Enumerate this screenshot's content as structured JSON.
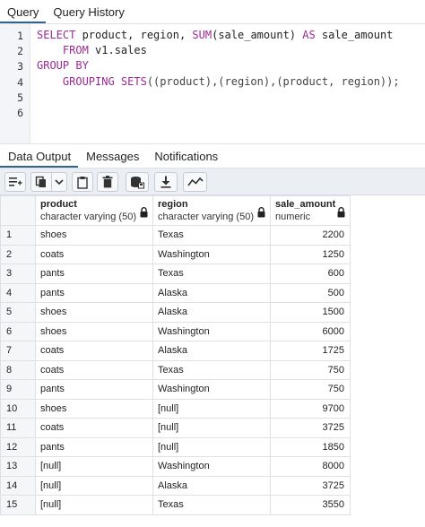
{
  "query_tabs": [
    "Query",
    "Query History"
  ],
  "editor": {
    "line_numbers": [
      "1",
      "2",
      "3",
      "4",
      "5",
      "6"
    ],
    "lines": [
      [
        {
          "t": "SELECT",
          "k": "kw"
        },
        {
          "t": " product, region, ",
          "k": "id"
        },
        {
          "t": "SUM",
          "k": "kw"
        },
        {
          "t": "(sale_amount) ",
          "k": "id"
        },
        {
          "t": "AS",
          "k": "kw"
        },
        {
          "t": " sale_amount",
          "k": "id"
        }
      ],
      [
        {
          "t": "    ",
          "k": "id"
        },
        {
          "t": "FROM",
          "k": "kw"
        },
        {
          "t": " v1.sales",
          "k": "id"
        }
      ],
      [
        {
          "t": "GROUP BY",
          "k": "kw"
        }
      ],
      [
        {
          "t": "    ",
          "k": "id"
        },
        {
          "t": "GROUPING SETS",
          "k": "kw"
        },
        {
          "t": "((product),(region),(product, region));",
          "k": "ph"
        }
      ],
      [],
      []
    ]
  },
  "result_tabs": [
    "Data Output",
    "Messages",
    "Notifications"
  ],
  "toolbar": {
    "icons": [
      "add-row-icon",
      "copy-icon",
      "dropdown-chevron-icon",
      "paste-icon",
      "delete-icon",
      "save-data-icon",
      "download-icon",
      "graph-icon"
    ]
  },
  "grid": {
    "columns": [
      {
        "name": "product",
        "type": "character varying (50)"
      },
      {
        "name": "region",
        "type": "character varying (50)"
      },
      {
        "name": "sale_amount",
        "type": "numeric"
      }
    ],
    "null_text": "[null]",
    "rows": [
      [
        "1",
        "shoes",
        "Texas",
        "2200"
      ],
      [
        "2",
        "coats",
        "Washington",
        "1250"
      ],
      [
        "3",
        "pants",
        "Texas",
        "600"
      ],
      [
        "4",
        "pants",
        "Alaska",
        "500"
      ],
      [
        "5",
        "shoes",
        "Alaska",
        "1500"
      ],
      [
        "6",
        "shoes",
        "Washington",
        "6000"
      ],
      [
        "7",
        "coats",
        "Alaska",
        "1725"
      ],
      [
        "8",
        "coats",
        "Texas",
        "750"
      ],
      [
        "9",
        "pants",
        "Washington",
        "750"
      ],
      [
        "10",
        "shoes",
        null,
        "9700"
      ],
      [
        "11",
        "coats",
        null,
        "3725"
      ],
      [
        "12",
        "pants",
        null,
        "1850"
      ],
      [
        "13",
        null,
        "Washington",
        "8000"
      ],
      [
        "14",
        null,
        "Alaska",
        "3725"
      ],
      [
        "15",
        null,
        "Texas",
        "3550"
      ]
    ]
  },
  "colors": {
    "keyword": "#9b2a93",
    "active_tab_underline": "#326690",
    "null_text": "#b7b9bd"
  }
}
